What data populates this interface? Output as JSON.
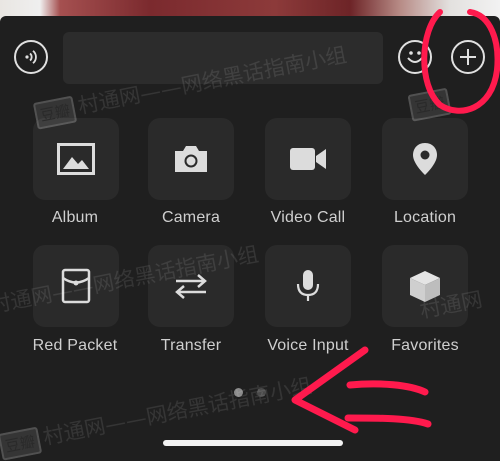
{
  "input_bar": {
    "voice_icon": "voice-wave-icon",
    "emoji_icon": "smiley-icon",
    "plus_icon": "plus-circle-icon",
    "text_value": ""
  },
  "actions": [
    {
      "label": "Album",
      "icon": "image-icon"
    },
    {
      "label": "Camera",
      "icon": "camera-icon"
    },
    {
      "label": "Video Call",
      "icon": "video-camera-icon"
    },
    {
      "label": "Location",
      "icon": "location-pin-icon"
    },
    {
      "label": "Red Packet",
      "icon": "red-packet-icon"
    },
    {
      "label": "Transfer",
      "icon": "transfer-arrows-icon"
    },
    {
      "label": "Voice Input",
      "icon": "microphone-icon"
    },
    {
      "label": "Favorites",
      "icon": "cube-icon"
    }
  ],
  "pager": {
    "page_count": 2,
    "current_page": 1
  },
  "watermark": {
    "badge": "豆瓣",
    "text": "村通网——网络黑话指南小组",
    "short": "村通网"
  },
  "colors": {
    "background": "#1f1f1f",
    "tile": "#2a2a2a",
    "annotation": "#ff1a4d"
  }
}
